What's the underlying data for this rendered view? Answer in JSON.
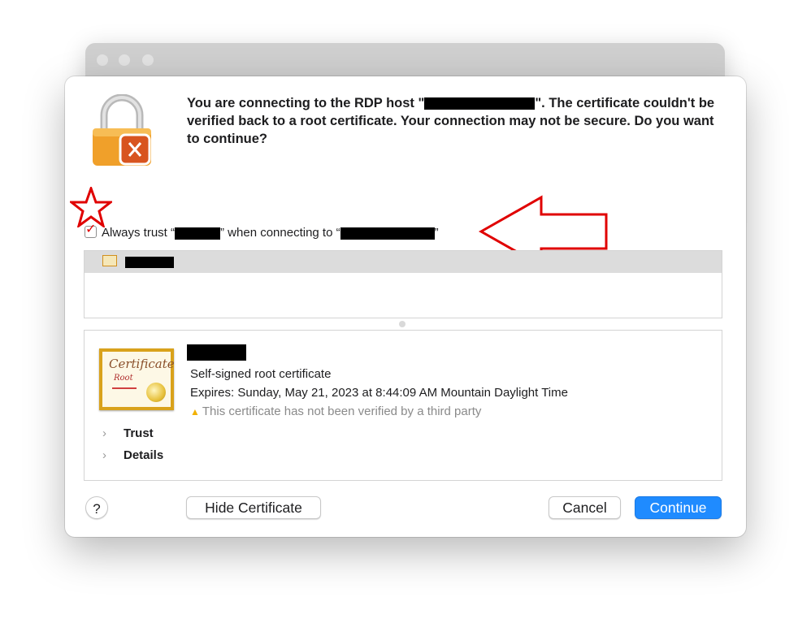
{
  "dialog": {
    "message_prefix": "You are connecting to the RDP host \"",
    "message_suffix": "\". The certificate couldn't be verified back to a root certificate. Your connection may not be secure. Do you want to continue?",
    "trust_checkbox": {
      "prefix": "Always trust “",
      "middle": "” when connecting to “",
      "suffix": "”",
      "checked": true
    },
    "certificate": {
      "image_title": "Certificate",
      "image_subtitle": "Root",
      "type": "Self-signed root certificate",
      "expires": "Expires: Sunday, May 21, 2023 at 8:44:09 AM Mountain Daylight Time",
      "warning": "This certificate has not been verified by a third party",
      "sections": [
        "Trust",
        "Details"
      ]
    },
    "buttons": {
      "help": "?",
      "hide_certificate": "Hide Certificate",
      "cancel": "Cancel",
      "continue": "Continue"
    }
  },
  "colors": {
    "accent": "#1f8bff",
    "annotation_red": "#e00000",
    "warning_yellow": "#f2b100"
  }
}
